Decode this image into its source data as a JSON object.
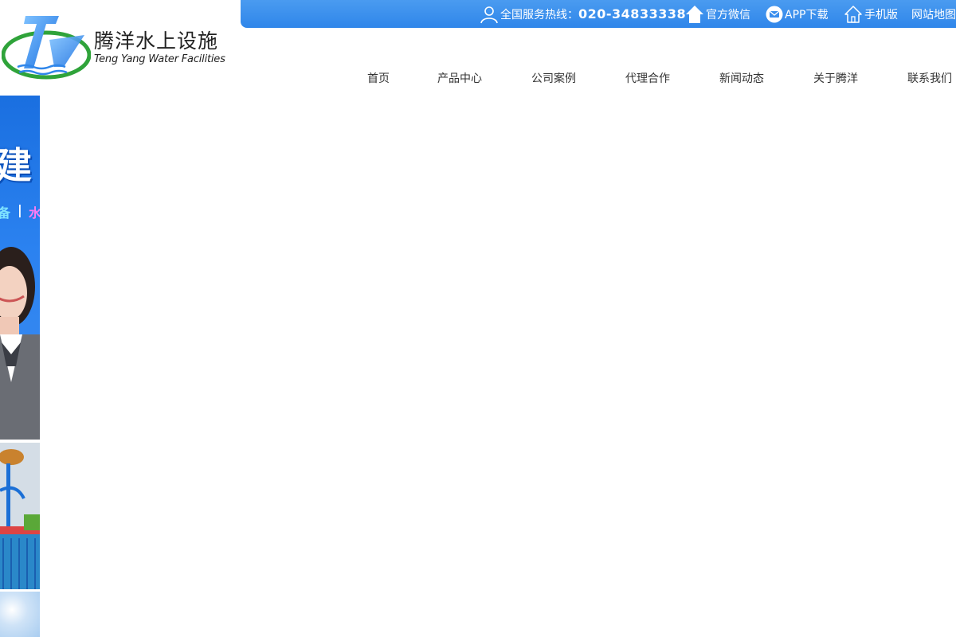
{
  "topbar": {
    "hotline_label": "全国服务热线：",
    "hotline_number": "020-34833338",
    "wechat_label": "官方微信",
    "app_label": "APP下载",
    "mobile_label": "手机版",
    "sitemap_label": "网站地图"
  },
  "logo": {
    "name_cn": "腾洋水上设施",
    "name_en": "Teng Yang Water Facilities",
    "mark_letters": "T"
  },
  "nav": {
    "items": [
      "首页",
      "产品中心",
      "公司案例",
      "代理合作",
      "新闻动态",
      "关于腾洋",
      "联系我们"
    ]
  },
  "banner": {
    "big_text": "建",
    "sub_text_1": "备",
    "sub_text_2": "|",
    "sub_text_3": "水"
  },
  "colors": {
    "topbar_blue": "#3a8eed",
    "logo_green": "#2fa33a",
    "logo_blue": "#2f86ea",
    "banner_blue": "#1a6fe0"
  },
  "icons": {
    "hotline": "user-icon",
    "wechat": "home-icon",
    "app": "mail-icon",
    "mobile": "home-outline-icon"
  }
}
